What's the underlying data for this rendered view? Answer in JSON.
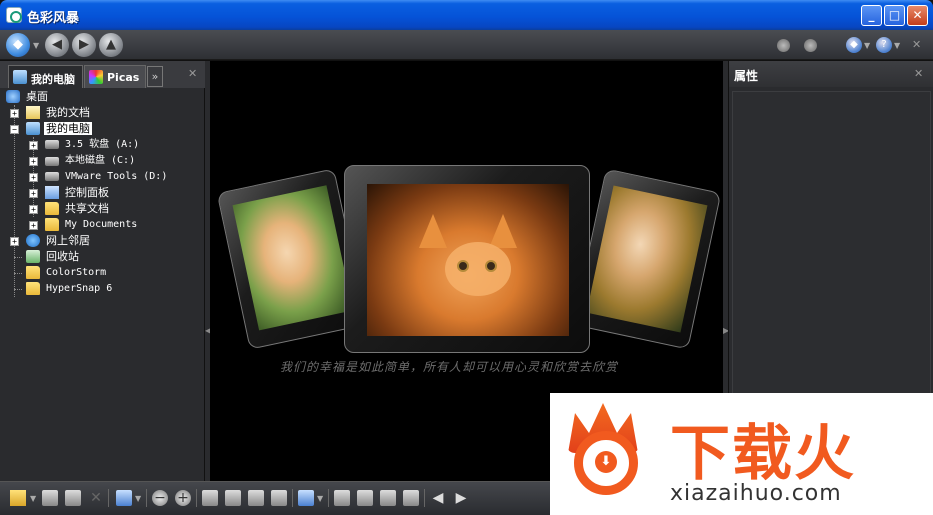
{
  "window": {
    "title": "色彩风暴",
    "minimize_label": "_",
    "maximize_label": "□",
    "close_label": "✕"
  },
  "navbar": {
    "home_glyph": "◆",
    "back_glyph": "◀",
    "forward_glyph": "▶",
    "up_glyph": "▲",
    "help_glyph": "?",
    "close_glyph": "✕"
  },
  "left_panel": {
    "tabs": [
      {
        "label": "我的电脑",
        "icon": "computer-icon"
      },
      {
        "label": "Picas",
        "icon": "picasa-icon"
      }
    ],
    "more_glyph": "»",
    "close_glyph": "✕",
    "tree": [
      {
        "label": "桌面",
        "icon": "desktop-icon"
      },
      {
        "label": "我的文档",
        "icon": "documents-icon"
      },
      {
        "label": "我的电脑",
        "icon": "computer-icon",
        "selected": true
      },
      {
        "label": "3.5 软盘 (A:)",
        "icon": "floppy-icon"
      },
      {
        "label": "本地磁盘 (C:)",
        "icon": "drive-icon"
      },
      {
        "label": "VMware Tools (D:)",
        "icon": "cd-drive-icon"
      },
      {
        "label": "控制面板",
        "icon": "control-panel-icon"
      },
      {
        "label": "共享文档",
        "icon": "folder-icon"
      },
      {
        "label": "My Documents",
        "icon": "folder-icon"
      },
      {
        "label": "网上邻居",
        "icon": "network-icon"
      },
      {
        "label": "回收站",
        "icon": "recycle-bin-icon"
      },
      {
        "label": "ColorStorm",
        "icon": "folder-icon"
      },
      {
        "label": "HyperSnap 6",
        "icon": "folder-icon"
      }
    ]
  },
  "viewer": {
    "caption": "我们的幸福是如此简单，所有人却可以用心灵和欣赏去欣赏"
  },
  "right_panel": {
    "title": "属性",
    "close_glyph": "✕"
  },
  "bottom_toolbar": {
    "prev_glyph": "◀",
    "next_glyph": "▶",
    "zoom_out_glyph": "−",
    "zoom_in_glyph": "+"
  },
  "watermark": {
    "brand": "下载火",
    "url": "xiazaihuo.com",
    "download_glyph": "⬇"
  },
  "colors": {
    "titlebar": "#0553d8",
    "panel_bg": "#2a2b2e",
    "viewer_bg": "#000000",
    "brand_orange": "#f15a1f"
  }
}
